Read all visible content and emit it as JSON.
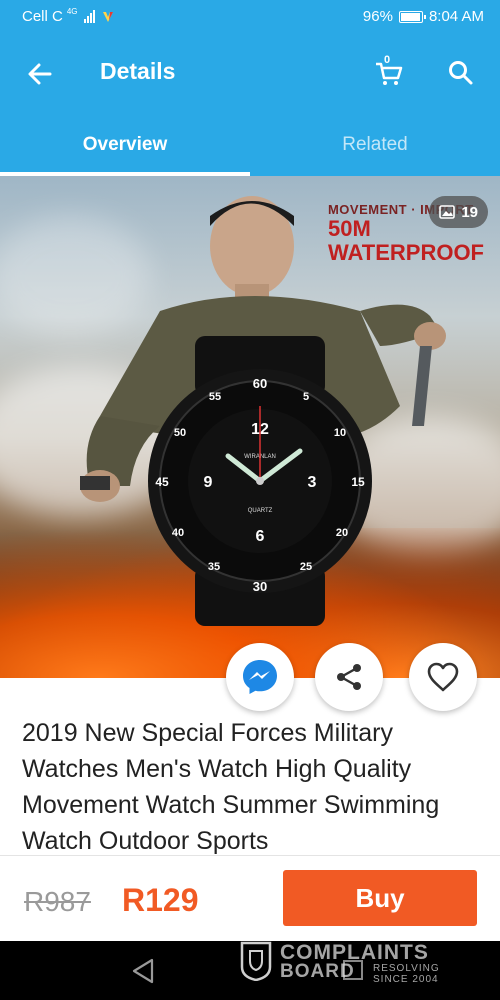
{
  "status_bar": {
    "carrier": "Cell C",
    "network_type": "4G",
    "battery": "96%",
    "battery_level": 0.96,
    "time": "8:04 AM"
  },
  "app_bar": {
    "title": "Details",
    "cart_count": "0",
    "icons": [
      "back-arrow-icon",
      "cart-icon",
      "search-icon"
    ]
  },
  "tabs": [
    {
      "label": "Overview",
      "active": true
    },
    {
      "label": "Related",
      "active": false
    }
  ],
  "product_image": {
    "overlay_line1": "MOVEMENT · IMPORT",
    "overlay_line2": "50M",
    "overlay_line3": "WATERPROOF",
    "photo_count": "19",
    "watch_brand": "WIRANLAN",
    "watch_quartz": "QUARTZ",
    "watch_numbers": [
      "60",
      "55",
      "5",
      "50",
      "10",
      "15",
      "45",
      "40",
      "20",
      "35",
      "25",
      "30"
    ],
    "watch_hours": [
      "12",
      "9",
      "3",
      "6"
    ]
  },
  "actions": {
    "messenger_icon": "messenger-icon",
    "share_icon": "share-icon",
    "wishlist_icon": "heart-icon"
  },
  "product": {
    "title": "2019 New Special Forces Military Watches Men's Watch High Quality Movement Watch Summer Swimming Watch Outdoor Sports"
  },
  "price_bar": {
    "old_price": "R987",
    "price": "R129",
    "buy_label": "Buy",
    "accent_color": "#f15a24"
  },
  "watermark": {
    "line1": "COMPLAINTS",
    "line2": "BOARD",
    "sub1": "RESOLVING",
    "sub2": "SINCE 2004"
  },
  "theme": {
    "primary": "#2aa9e6"
  }
}
